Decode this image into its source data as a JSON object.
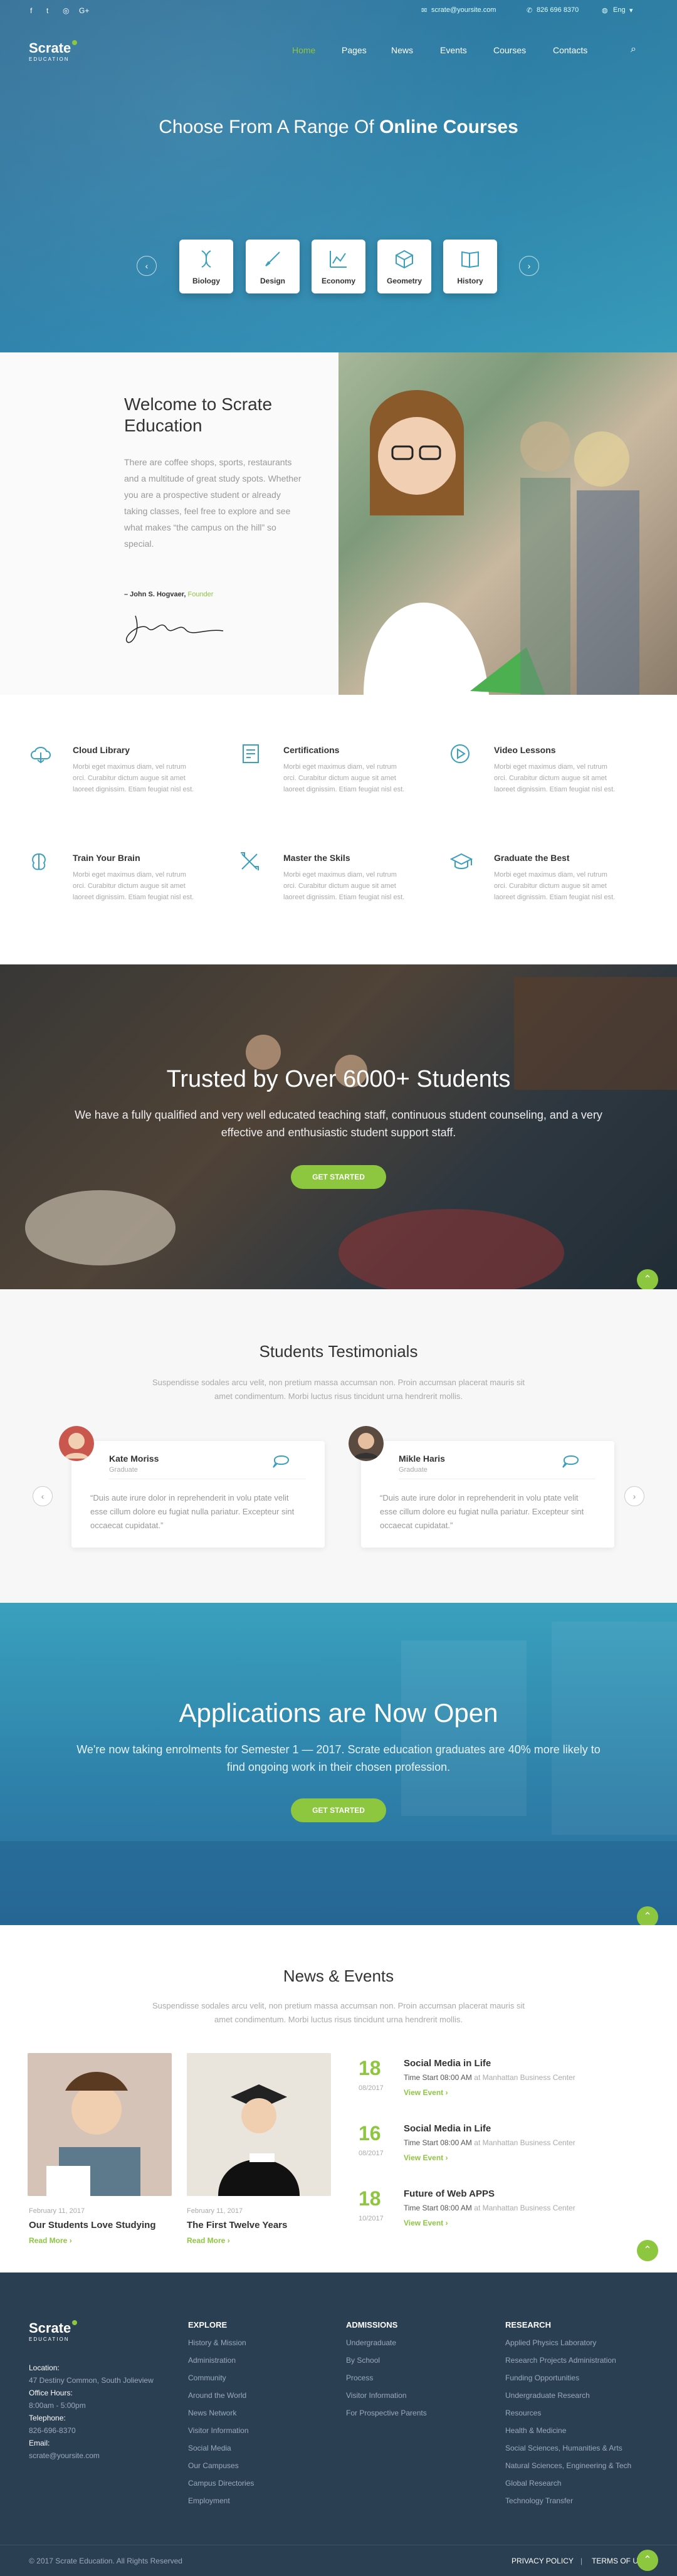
{
  "topbar": {
    "email": "scrate@yoursite.com",
    "phone": "826 696 8370",
    "lang": "Eng"
  },
  "logo": {
    "name": "Scrate",
    "sub": "EDUCATION"
  },
  "nav": [
    "Home",
    "Pages",
    "News",
    "Events",
    "Courses",
    "Contacts"
  ],
  "hero": {
    "title_a": "Choose From A Range Of",
    "title_b": "Online Courses",
    "courses": [
      "Biology",
      "Design",
      "Economy",
      "Geometry",
      "History"
    ]
  },
  "welcome": {
    "title_a": "Welcome",
    "title_b": "to Scrate Education",
    "text": "There are coffee shops, sports, restaurants and a multitude of great study spots. Whether you are a prospective student or already taking classes, feel free to explore and see what makes “the campus on the hill” so special.",
    "author": "– John S. Hogvaer,",
    "author_role": "Founder"
  },
  "features": [
    {
      "title": "Cloud Library",
      "text": "Morbi eget maximus diam, vel rutrum orci. Curabitur dictum augue sit amet laoreet dignissim. Etiam feugiat nisl est."
    },
    {
      "title": "Certifications",
      "text": "Morbi eget maximus diam, vel rutrum orci. Curabitur dictum augue sit amet laoreet dignissim. Etiam feugiat nisl est."
    },
    {
      "title": "Video Lessons",
      "text": "Morbi eget maximus diam, vel rutrum orci. Curabitur dictum augue sit amet laoreet dignissim. Etiam feugiat nisl est."
    },
    {
      "title": "Train Your Brain",
      "text": "Morbi eget maximus diam, vel rutrum orci. Curabitur dictum augue sit amet laoreet dignissim. Etiam feugiat nisl est."
    },
    {
      "title": "Master the Skils",
      "text": "Morbi eget maximus diam, vel rutrum orci. Curabitur dictum augue sit amet laoreet dignissim. Etiam feugiat nisl est."
    },
    {
      "title": "Graduate the Best",
      "text": "Morbi eget maximus diam, vel rutrum orci. Curabitur dictum augue sit amet laoreet dignissim. Etiam feugiat nisl est."
    }
  ],
  "trusted": {
    "title_a": "Trusted by Over",
    "title_b": "6000+ Students",
    "text": "We have a fully qualified and very well educated teaching staff, continuous student counseling, and a very effective and enthusiastic student support staff.",
    "button": "GET STARTED"
  },
  "testimonials": {
    "title_a": "Students",
    "title_b": "Testimonials",
    "sub": "Suspendisse sodales arcu velit, non pretium massa accumsan non. Proin accumsan placerat mauris sit amet condimentum. Morbi luctus risus tincidunt urna hendrerit mollis.",
    "items": [
      {
        "name": "Kate Moriss",
        "role": "Graduate",
        "quote": "“Duis aute irure dolor in reprehenderit in volu ptate velit esse cillum dolore eu fugiat nulla pariatur. Excepteur sint occaecat cupidatat.”"
      },
      {
        "name": "Mikle Haris",
        "role": "Graduate",
        "quote": "“Duis aute irure dolor in reprehenderit in volu ptate velit esse cillum dolore eu fugiat nulla pariatur. Excepteur sint occaecat cupidatat.”"
      }
    ]
  },
  "apps": {
    "title_a": "Applications are",
    "title_b": "Now Open",
    "text": "We're now taking enrolments for Semester 1 — 2017. Scrate education graduates are 40% more likely to find ongoing work in their chosen profession.",
    "button": "GET STARTED"
  },
  "news": {
    "title_a": "News &",
    "title_b": "Events",
    "sub": "Suspendisse sodales arcu velit, non pretium massa accumsan non. Proin accumsan placerat mauris sit amet condimentum. Morbi luctus risus tincidunt urna hendrerit mollis.",
    "posts": [
      {
        "date": "February 11, 2017",
        "title": "Our Students Love Studying",
        "link": "Read More"
      },
      {
        "date": "February 11, 2017",
        "title": "The First Twelve Years",
        "link": "Read More"
      }
    ],
    "events": [
      {
        "day": "18",
        "month": "08/2017",
        "title": "Social Media in Life",
        "time": "Time Start 08:00 AM",
        "place": "at Manhattan Business Center",
        "link": "View Event"
      },
      {
        "day": "16",
        "month": "08/2017",
        "title": "Social Media in Life",
        "time": "Time Start 08:00 AM",
        "place": "at Manhattan Business Center",
        "link": "View Event"
      },
      {
        "day": "18",
        "month": "10/2017",
        "title": "Future of Web APPS",
        "time": "Time Start 08:00 AM",
        "place": "at Manhattan Business Center",
        "link": "View Event"
      }
    ]
  },
  "footer": {
    "location_label": "Location:",
    "location": "47 Destiny Common, South Jolieview",
    "hours_label": "Office Hours:",
    "hours": "8:00am - 5:00pm",
    "phone_label": "Telephone:",
    "phone": "826-696-8370",
    "email_label": "Email:",
    "email": "scrate@yoursite.com",
    "cols": [
      {
        "title": "EXPLORE",
        "items": [
          "History & Mission",
          "Administration",
          "Community",
          "Around the World",
          "News Network",
          "Visitor Information",
          "Social Media",
          "Our Campuses",
          "Campus Directories",
          "Employment"
        ]
      },
      {
        "title": "ADMISSIONS",
        "items": [
          "Undergraduate",
          "By School",
          "Process",
          "Visitor Information",
          "For Prospective Parents"
        ]
      },
      {
        "title": "RESEARCH",
        "items": [
          "Applied Physics Laboratory",
          "Research Projects Administration",
          "Funding Opportunities",
          "Undergraduate Research",
          "Resources",
          "Health & Medicine",
          "Social Sciences, Humanities & Arts",
          "Natural Sciences, Engineering & Tech",
          "Global Research",
          "Technology Transfer"
        ]
      }
    ],
    "copyright": "© 2017 Scrate Education. All Rights Reserved",
    "privacy": "PRIVACY POLICY",
    "sep": "|",
    "terms": "TERMS OF USE"
  }
}
